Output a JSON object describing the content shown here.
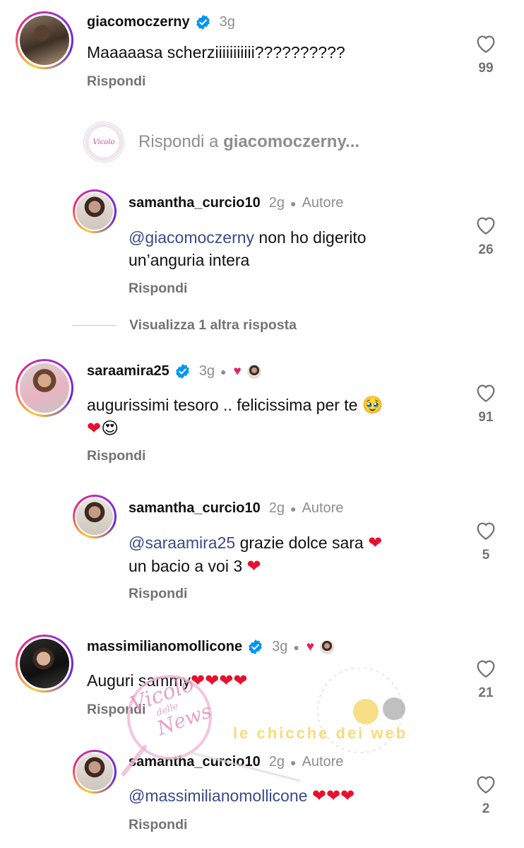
{
  "comments": [
    {
      "username": "giacomoczerny",
      "time": "3g",
      "text": "Maaaaasa scherziiiiiiiiiii??????????",
      "likes": "99",
      "reply": "Rispondi"
    },
    {
      "username": "samantha_curcio10",
      "time": "2g",
      "author": "Autore",
      "mention": "@giacomoczerny",
      "text_line1": " non ho digerito",
      "text_line2": "un’anguria intera",
      "likes": "26",
      "reply": "Rispondi"
    },
    {
      "username": "saraamira25",
      "time": "3g",
      "text_line1": "augurissimi tesoro .. felicissima per te",
      "likes": "91",
      "reply": "Rispondi"
    },
    {
      "username": "samantha_curcio10",
      "time": "2g",
      "author": "Autore",
      "mention": "@saraamira25",
      "text_line1": " grazie dolce sara",
      "text_line2": "un bacio a voi 3",
      "likes": "5",
      "reply": "Rispondi"
    },
    {
      "username": "massimilianomollicone",
      "time": "3g",
      "text": "Auguri sammy",
      "likes": "21",
      "reply": "Rispondi"
    },
    {
      "username": "samantha_curcio10",
      "time": "2g",
      "author": "Autore",
      "mention": "@massimilianomollicone",
      "likes": "2",
      "reply": "Rispondi"
    }
  ],
  "reply_input": {
    "prefix": "Rispondi a ",
    "target": "giacomoczerny..."
  },
  "view_more": "Visualizza 1 altra risposta",
  "watermark": {
    "brand_line1": "Vicolo",
    "brand_line2": "delle",
    "brand_line3": "News",
    "tagline": "le chicche dei web"
  },
  "colors": {
    "verified": "#0095f6",
    "heart_red": "#e8102e",
    "mention": "#3b4a8c",
    "muted": "#8e8e8e"
  },
  "icons": [
    "verified-badge-icon",
    "heart-outline-icon",
    "red-heart-icon",
    "pleading-face-emoji",
    "heart-eyes-emoji"
  ]
}
